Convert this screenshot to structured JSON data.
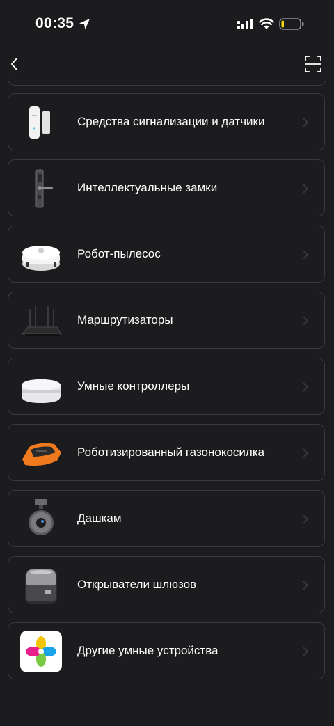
{
  "status_bar": {
    "time": "00:35",
    "icons": [
      "location-arrow-icon",
      "cellular-signal-icon",
      "wifi-icon",
      "battery-low-icon"
    ],
    "battery_color": "#f5d90a"
  },
  "nav": {
    "back_icon": "chevron-left-icon",
    "scan_icon": "scan-frame-icon"
  },
  "categories": [
    {
      "label": "Средства сигнализации и датчики",
      "icon": "door-sensor-icon"
    },
    {
      "label": "Интеллектуальные замки",
      "icon": "smart-lock-icon"
    },
    {
      "label": "Робот-пылесос",
      "icon": "robot-vacuum-icon"
    },
    {
      "label": "Маршрутизаторы",
      "icon": "router-icon"
    },
    {
      "label": "Умные контроллеры",
      "icon": "smart-hub-icon"
    },
    {
      "label": "Роботизированный газонокосилка",
      "icon": "lawn-mower-icon"
    },
    {
      "label": "Дашкам",
      "icon": "dashcam-icon"
    },
    {
      "label": "Открыватели шлюзов",
      "icon": "gate-opener-icon"
    },
    {
      "label": "Другие умные устройства",
      "icon": "app-logo-icon"
    }
  ],
  "colors": {
    "background": "#1c1c1e",
    "card_border": "#3a3a3c",
    "mower_orange": "#f07a1e"
  }
}
